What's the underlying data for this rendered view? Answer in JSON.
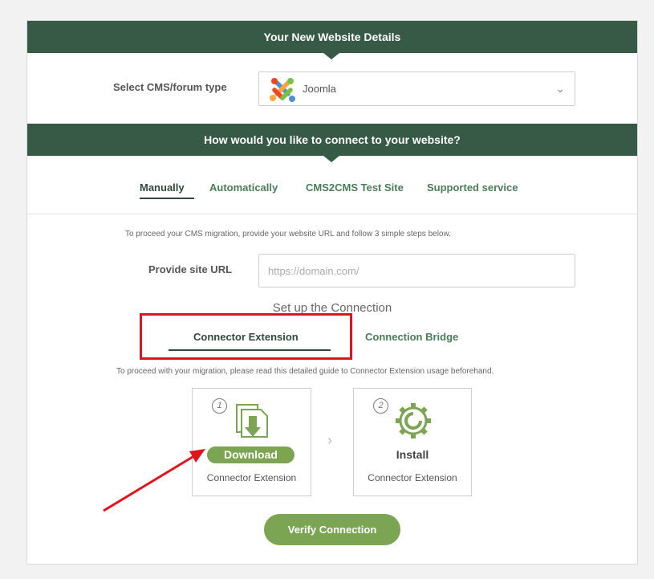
{
  "header": {
    "details_title": "Your New Website Details",
    "connect_title": "How would you like to connect to your website?"
  },
  "cms": {
    "label": "Select CMS/forum type",
    "selected": "Joomla",
    "logo_icon": "joomla-logo"
  },
  "tabs": {
    "manually": "Manually",
    "automatically": "Automatically",
    "test_site": "CMS2CMS Test Site",
    "supported": "Supported service"
  },
  "manual": {
    "intro": "To proceed your CMS migration, provide your website URL and follow 3 simple steps below.",
    "url_label": "Provide site URL",
    "url_placeholder": "https://domain.com/",
    "setup_title": "Set up the Connection",
    "subtab_extension": "Connector Extension",
    "subtab_bridge": "Connection Bridge",
    "guide_hint": "To proceed with your migration, please read this detailed guide to Connector Extension usage beforehand."
  },
  "steps": [
    {
      "number": "1",
      "action": "Download",
      "caption": "Connector Extension",
      "icon": "download-folder-icon"
    },
    {
      "number": "2",
      "action": "Install",
      "caption": "Connector Extension",
      "icon": "gear-install-icon"
    }
  ],
  "verify_label": "Verify Connection",
  "colors": {
    "band": "#375a47",
    "accent_green": "#7ba552",
    "tab_green": "#4a7c58",
    "annotation_red": "#e0141b"
  }
}
